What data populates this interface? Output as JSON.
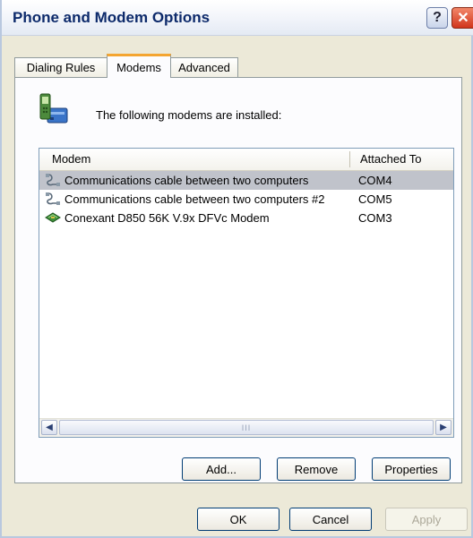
{
  "window": {
    "title": "Phone and Modem Options"
  },
  "titlebar": {
    "help_label": "?",
    "close_label": "✕"
  },
  "tabs": [
    {
      "label": "Dialing Rules",
      "active": false
    },
    {
      "label": "Modems",
      "active": true
    },
    {
      "label": "Advanced",
      "active": false
    }
  ],
  "modems_tab": {
    "info_text": "The following modems are installed:",
    "columns": [
      "Modem",
      "Attached To"
    ],
    "rows": [
      {
        "name": "Communications cable between two computers",
        "port": "COM4",
        "icon": "cable-icon",
        "selected": true
      },
      {
        "name": "Communications cable between two computers #2",
        "port": "COM5",
        "icon": "cable-icon",
        "selected": false
      },
      {
        "name": "Conexant D850 56K V.9x DFVc Modem",
        "port": "COM3",
        "icon": "modem-card-icon",
        "selected": false
      }
    ],
    "scrollbar_thumb_grip": "III",
    "buttons": {
      "add": "Add...",
      "remove": "Remove",
      "properties": "Properties"
    }
  },
  "footer": {
    "ok": "OK",
    "cancel": "Cancel",
    "apply": "Apply"
  },
  "colors": {
    "selected_row": "#c0c3cb",
    "tab_highlight": "#f4a531",
    "close_button": "#d1351b"
  }
}
